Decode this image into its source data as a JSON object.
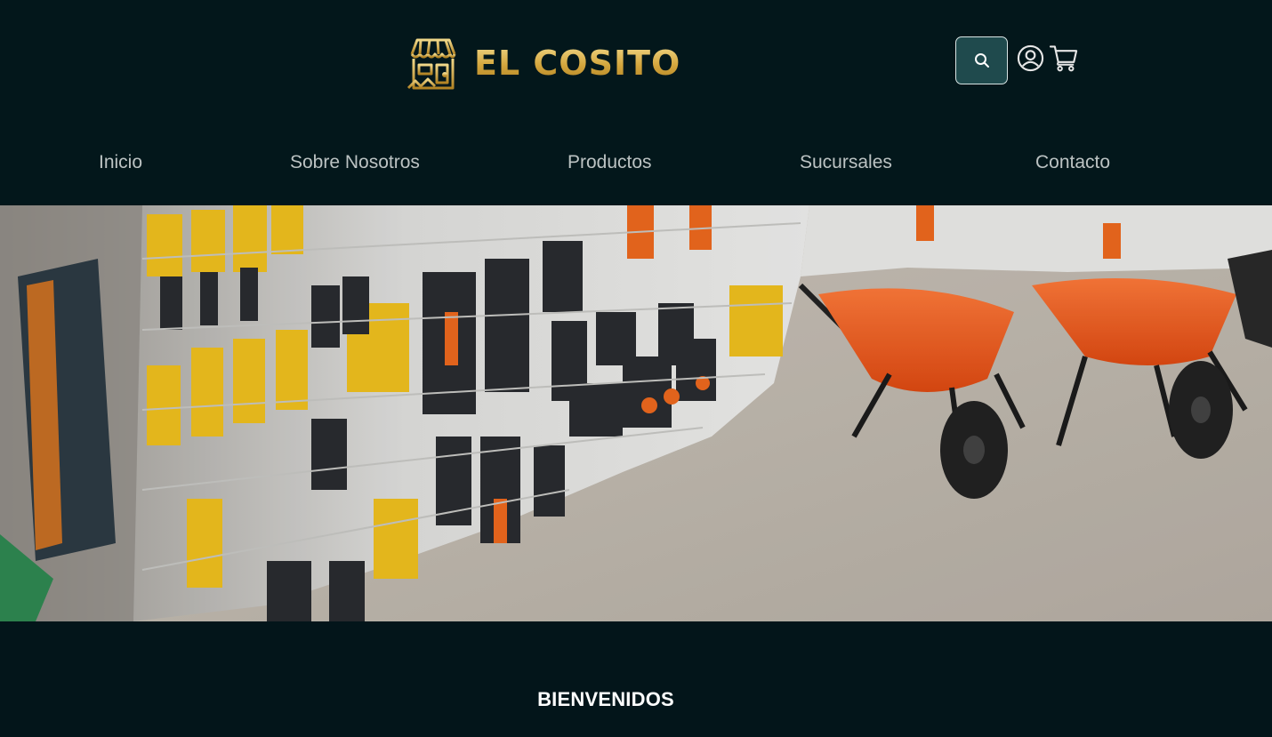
{
  "brand": {
    "name": "EL COSITO",
    "colors": {
      "gold": "#d4a63d",
      "background": "#03171b",
      "search_button": "#1f4a4d"
    }
  },
  "header": {
    "icons": {
      "search": "search-icon",
      "user": "user-circle-icon",
      "cart": "shopping-cart-icon"
    }
  },
  "nav": {
    "items": [
      {
        "label": "Inicio"
      },
      {
        "label": "Sobre Nosotros"
      },
      {
        "label": "Productos"
      },
      {
        "label": "Sucursales"
      },
      {
        "label": "Contacto"
      }
    ]
  },
  "hero": {
    "image": "hardware-store-photo",
    "description_icons": [
      "tool-wall",
      "wheelbarrow"
    ]
  },
  "welcome": {
    "heading": "BIENVENIDOS"
  }
}
